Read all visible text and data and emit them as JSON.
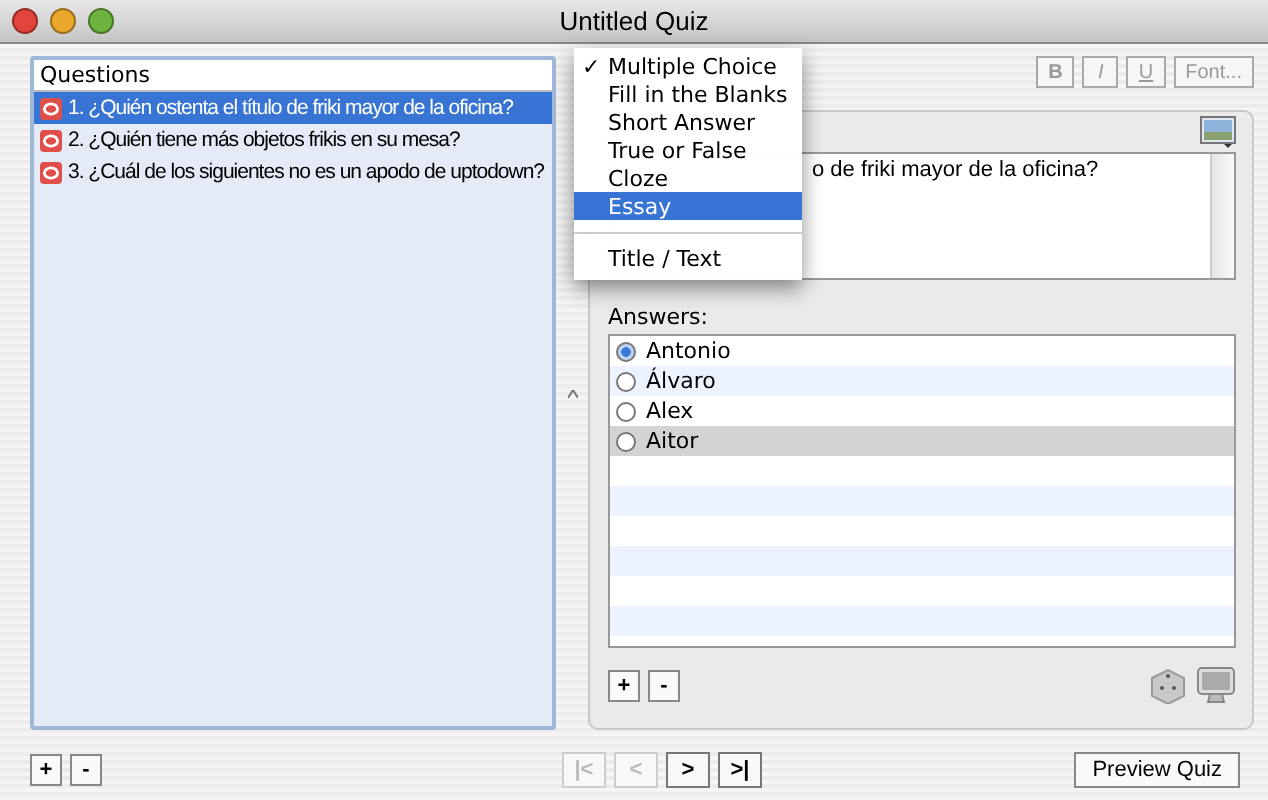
{
  "window": {
    "title": "Untitled Quiz"
  },
  "questions": {
    "header": "Questions",
    "items": [
      {
        "text": "1. ¿Quién ostenta el título de friki mayor de la oficina?",
        "selected": true
      },
      {
        "text": "2. ¿Quién tiene más objetos frikis en su mesa?",
        "selected": false
      },
      {
        "text": "3. ¿Cuál de los siguientes no es un apodo de uptodown?",
        "selected": false
      }
    ],
    "buttons": [
      "+",
      "-"
    ]
  },
  "format_buttons": [
    "B",
    "I",
    "U",
    "Font..."
  ],
  "question_text": "o de friki mayor de la oficina?",
  "answers": {
    "label": "Answers:",
    "items": [
      {
        "text": "Antonio",
        "checked": true,
        "selected": false
      },
      {
        "text": "Álvaro",
        "checked": false,
        "selected": false
      },
      {
        "text": "Alex",
        "checked": false,
        "selected": false
      },
      {
        "text": "Aitor",
        "checked": false,
        "selected": true
      }
    ],
    "buttons": [
      "+",
      "-"
    ]
  },
  "navigation": [
    {
      "label": "|<",
      "disabled": true
    },
    {
      "label": "<",
      "disabled": true
    },
    {
      "label": ">",
      "disabled": false
    },
    {
      "label": ">|",
      "disabled": false
    }
  ],
  "preview_button": "Preview Quiz",
  "type_menu": {
    "check_mark": "✓",
    "items": [
      {
        "kind": "item",
        "label": "Multiple Choice",
        "checked": true,
        "selected": false
      },
      {
        "kind": "item",
        "label": "Fill in the Blanks",
        "checked": false,
        "selected": false
      },
      {
        "kind": "item",
        "label": "Short Answer",
        "checked": false,
        "selected": false
      },
      {
        "kind": "item",
        "label": "True or False",
        "checked": false,
        "selected": false
      },
      {
        "kind": "item",
        "label": "Cloze",
        "checked": false,
        "selected": false
      },
      {
        "kind": "item",
        "label": "Essay",
        "checked": false,
        "selected": true
      },
      {
        "kind": "separator"
      },
      {
        "kind": "item",
        "label": "Title / Text",
        "checked": false,
        "selected": false
      }
    ]
  }
}
